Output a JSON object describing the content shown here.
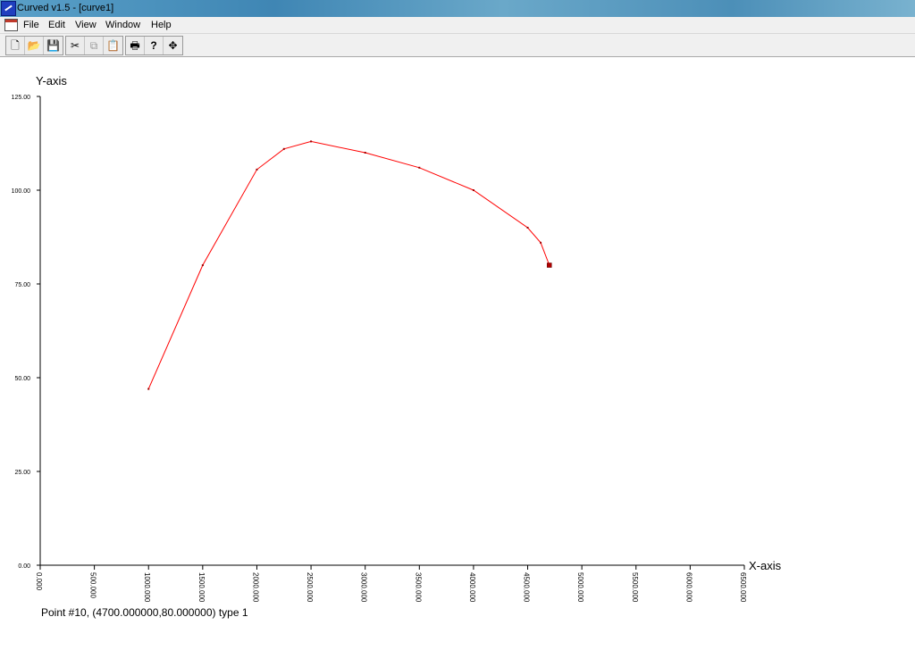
{
  "window": {
    "title": "Curved v1.5 - [curve1]"
  },
  "menu": [
    "File",
    "Edit",
    "View",
    "Window",
    "Help"
  ],
  "toolbar": {
    "new": "🗋",
    "open": "📂",
    "save": "💾",
    "cut": "✂",
    "copy": "⧉",
    "paste": "📋",
    "print": "🖶",
    "help": "?",
    "move": "✥"
  },
  "status": "Point #10, (4700.000000,80.000000) type 1",
  "chart_data": {
    "type": "line",
    "xlabel": "X-axis",
    "ylabel": "Y-axis",
    "xlim": [
      0,
      6500
    ],
    "ylim": [
      0,
      125
    ],
    "x_ticks": [
      "0.000",
      "500.000",
      "1000.000",
      "1500.000",
      "2000.000",
      "2500.000",
      "3000.000",
      "3500.000",
      "4000.000",
      "4500.000",
      "5000.000",
      "5500.000",
      "6000.000",
      "6500.000"
    ],
    "y_ticks": [
      "0.00",
      "25.00",
      "50.00",
      "75.00",
      "100.00",
      "125.00"
    ],
    "series": [
      {
        "color": "#ff0000",
        "x": [
          1000,
          1500,
          2000,
          2250,
          2500,
          3000,
          3500,
          4000,
          4500,
          4620,
          4700
        ],
        "y": [
          47,
          80,
          105.5,
          111,
          113,
          110,
          106,
          100,
          90,
          86,
          80
        ]
      }
    ],
    "selected_point": {
      "x": 4700,
      "y": 80,
      "color": "#b00000"
    }
  }
}
